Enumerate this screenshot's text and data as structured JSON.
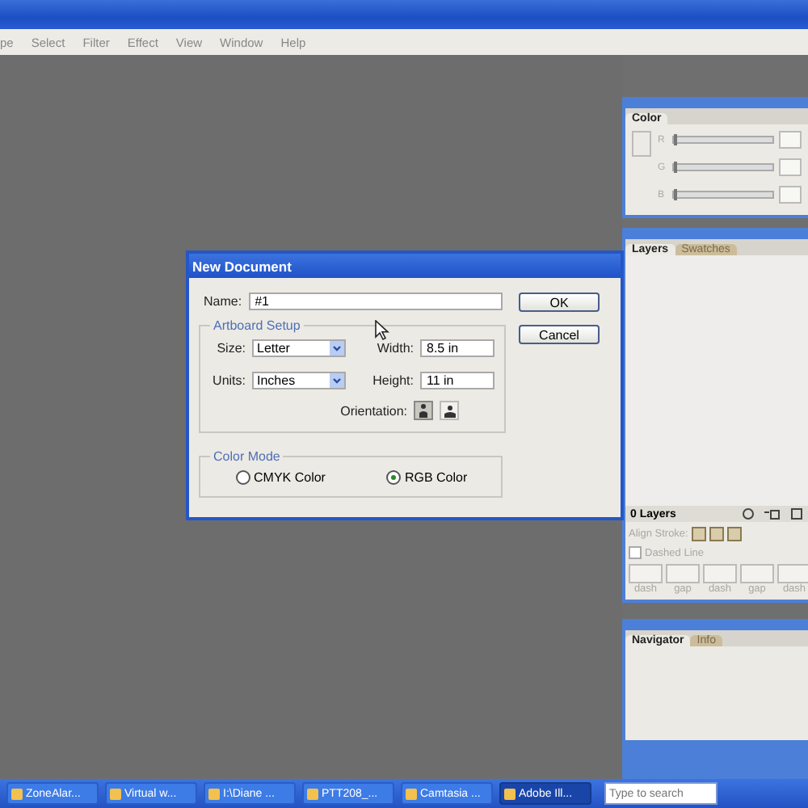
{
  "menu": [
    "pe",
    "Select",
    "Filter",
    "Effect",
    "View",
    "Window",
    "Help"
  ],
  "dialog": {
    "title": "New Document",
    "name_label": "Name:",
    "name_value": "#1",
    "ok": "OK",
    "cancel": "Cancel",
    "artboard": {
      "legend": "Artboard Setup",
      "size_label": "Size:",
      "size": "Letter",
      "units_label": "Units:",
      "units": "Inches",
      "width_label": "Width:",
      "width": "8.5 in",
      "height_label": "Height:",
      "height": "11 in",
      "orientation_label": "Orientation:",
      "orientations": [
        {
          "kind": "portrait",
          "selected": true
        },
        {
          "kind": "landscape",
          "selected": false
        }
      ]
    },
    "color_mode": {
      "legend": "Color Mode",
      "options": [
        {
          "label": "CMYK Color",
          "selected": false
        },
        {
          "label": "RGB Color",
          "selected": true
        }
      ]
    }
  },
  "color_panel": {
    "tab": "Color",
    "channels": [
      {
        "label": "R",
        "level": 0
      },
      {
        "label": "G",
        "level": 0
      },
      {
        "label": "B",
        "level": 0
      }
    ]
  },
  "layers_panel": {
    "tabs": [
      {
        "label": "Layers",
        "selected": true
      },
      {
        "label": "Swatches",
        "selected": false
      }
    ],
    "count": "0 Layers"
  },
  "stroke_panel": {
    "align_label": "Align Stroke:",
    "dashed_label": "Dashed Line",
    "dashed": false,
    "fields": [
      "dash",
      "gap",
      "dash",
      "gap",
      "dash"
    ]
  },
  "navigator_panel": {
    "tabs": [
      {
        "label": "Navigator",
        "selected": true
      },
      {
        "label": "Info",
        "selected": false
      }
    ]
  },
  "taskbar": {
    "items": [
      {
        "label": "ZoneAlar...",
        "selected": false
      },
      {
        "label": "Virtual w...",
        "selected": false
      },
      {
        "label": "I:\\Diane ...",
        "selected": false
      },
      {
        "label": "PTT208_...",
        "selected": false
      },
      {
        "label": "Camtasia ...",
        "selected": false
      },
      {
        "label": "Adobe Ill...",
        "selected": true
      }
    ],
    "search_placeholder": "Type to search"
  }
}
